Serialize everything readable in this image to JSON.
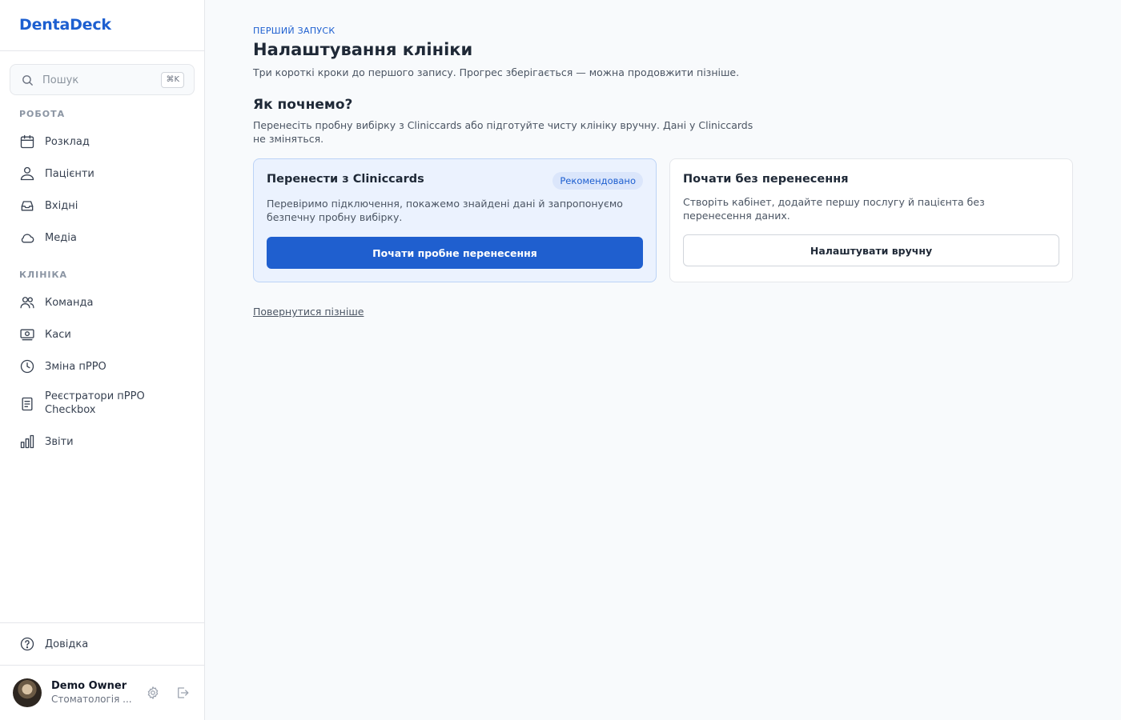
{
  "app": {
    "name": "DentaDeck"
  },
  "search": {
    "placeholder": "Пошук",
    "shortcut": "⌘K"
  },
  "nav": {
    "sections": [
      {
        "label": "РОБОТА",
        "items": [
          {
            "label": "Розклад",
            "icon": "calendar-icon"
          },
          {
            "label": "Пацієнти",
            "icon": "patients-icon"
          },
          {
            "label": "Вхідні",
            "icon": "inbox-icon"
          },
          {
            "label": "Медіа",
            "icon": "cloud-icon"
          }
        ]
      },
      {
        "label": "КЛІНІКА",
        "items": [
          {
            "label": "Команда",
            "icon": "team-icon"
          },
          {
            "label": "Каси",
            "icon": "cash-register-icon"
          },
          {
            "label": "Зміна пРРО",
            "icon": "clock-icon"
          },
          {
            "label": "Реєстратори пРРО Checkbox",
            "icon": "receipt-icon"
          },
          {
            "label": "Звіти",
            "icon": "bar-chart-icon"
          }
        ]
      }
    ],
    "help": {
      "label": "Довідка",
      "icon": "help-circle-icon"
    }
  },
  "user": {
    "name": "Demo Owner",
    "subtitle": "Стоматологія ..."
  },
  "main": {
    "eyebrow": "ПЕРШИЙ ЗАПУСК",
    "title": "Налаштування клініки",
    "subtitle": "Три короткі кроки до першого запису. Прогрес зберігається — можна продовжити пізніше.",
    "question": "Як почнемо?",
    "question_sub": "Перенесіть пробну вибірку з Cliniccards або підготуйте чисту клініку вручну. Дані у Cliniccards не зміняться.",
    "options": [
      {
        "title": "Перенести з Cliniccards",
        "badge": "Рекомендовано",
        "text": "Перевіримо підключення, покажемо знайдені дані й запропонуємо безпечну пробну вибірку.",
        "button": "Почати пробне перенесення"
      },
      {
        "title": "Почати без перенесення",
        "text": "Створіть кабінет, додайте першу послугу й пацієнта без перенесення даних.",
        "button": "Налаштувати вручну"
      }
    ],
    "later_link": "Повернутися пізніше"
  },
  "colors": {
    "accent": "#1f5fcf",
    "brand": "#1d5fd0",
    "recommended_bg": "#ebf2fe"
  }
}
